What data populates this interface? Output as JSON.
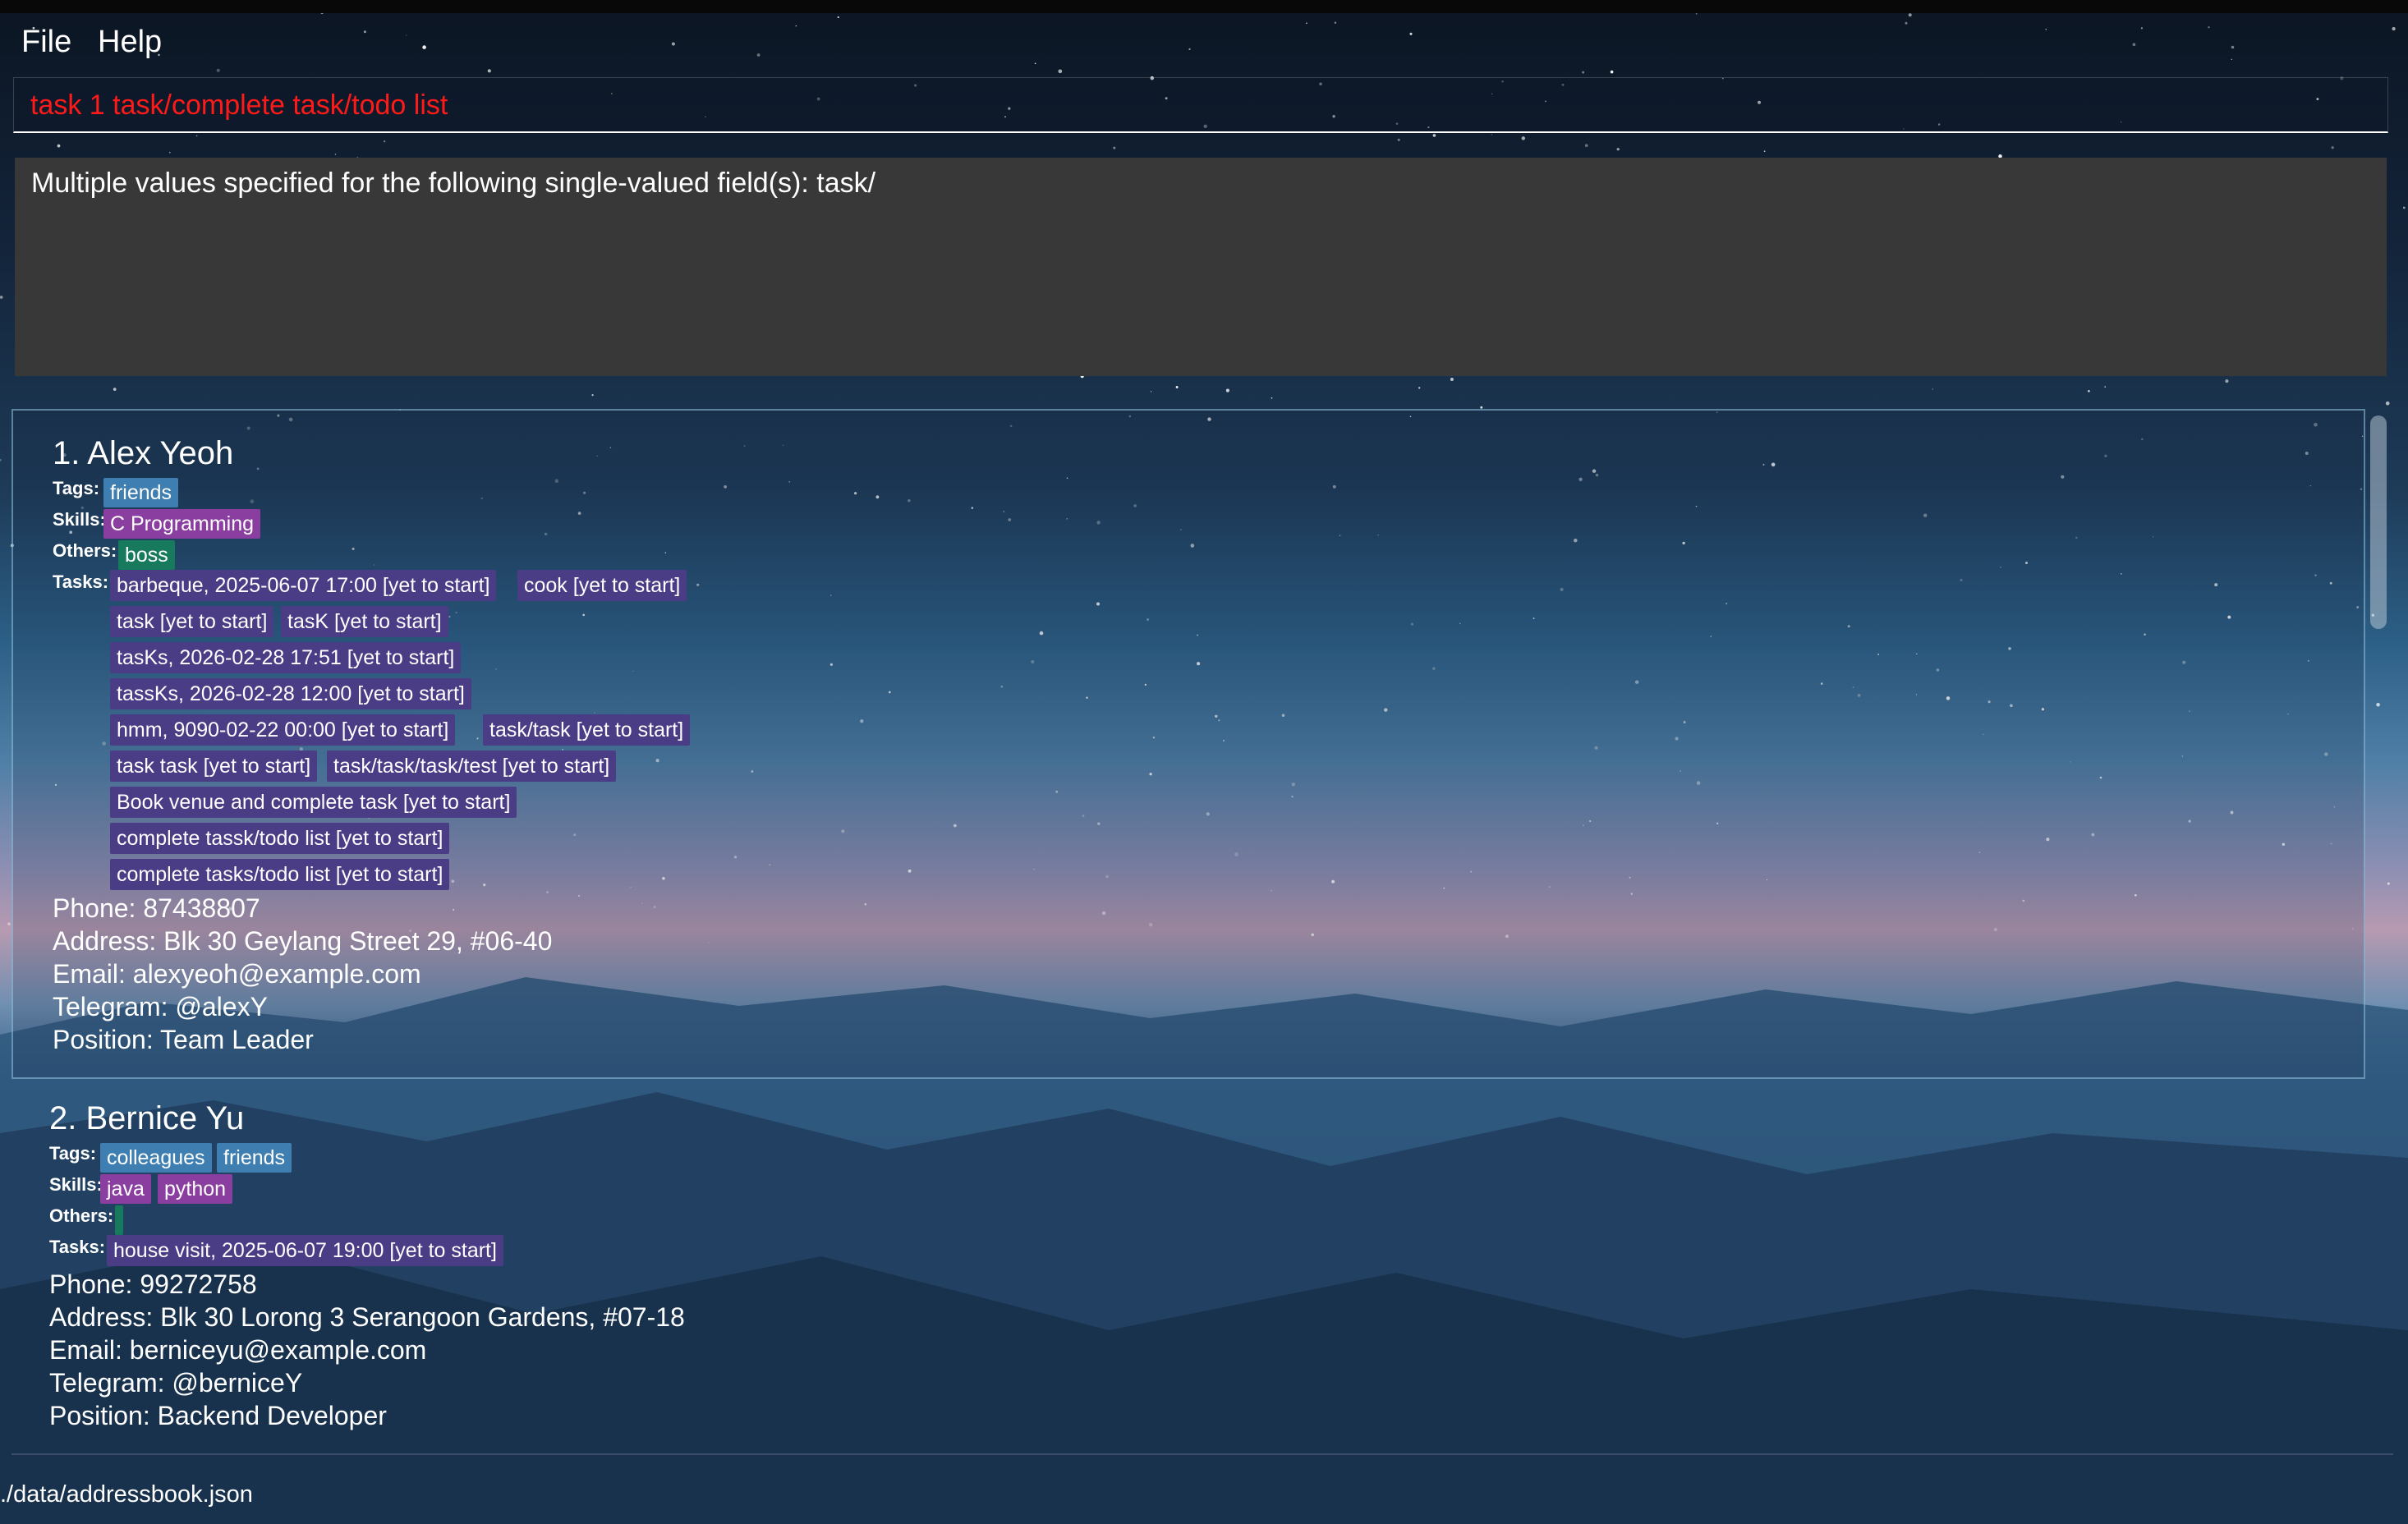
{
  "menu": {
    "file": "File",
    "help": "Help"
  },
  "command": {
    "value": "task 1 task/complete task/todo list",
    "color": "#ff1a1a"
  },
  "result": {
    "message": "Multiple values specified for the following single-valued field(s): task/"
  },
  "labels": {
    "tags": "Tags:",
    "skills": "Skills:",
    "others": "Others:",
    "tasks": "Tasks:"
  },
  "colors": {
    "tag": "#3e7eb0",
    "skill": "#8a3fa0",
    "other": "#187a5c",
    "task": "#4b3c86",
    "result_background": "#383838"
  },
  "persons": [
    {
      "name": "1. Alex Yeoh",
      "tags": [
        "friends"
      ],
      "skills": [
        "C Programming"
      ],
      "others": [
        "boss"
      ],
      "tasks": [
        "barbeque, 2025-06-07 17:00 [yet to start]",
        "cook [yet to start]",
        "task [yet to start]",
        "tasK [yet to start]",
        "tasKs, 2026-02-28 17:51 [yet to start]",
        "tassKs, 2026-02-28 12:00 [yet to start]",
        "hmm, 9090-02-22 00:00 [yet to start]",
        "task/task [yet to start]",
        "task task [yet to start]",
        "task/task/task/test [yet to start]",
        "Book venue and complete task [yet to start]",
        "complete tassk/todo list [yet to start]",
        "complete tasks/todo list [yet to start]"
      ],
      "phone": "Phone: 87438807",
      "address": "Address: Blk 30 Geylang Street 29, #06-40",
      "email": "Email: alexyeoh@example.com",
      "telegram": "Telegram: @alexY",
      "position": "Position: Team Leader"
    },
    {
      "name": "2. Bernice Yu",
      "tags": [
        "colleagues",
        "friends"
      ],
      "skills": [
        "java",
        "python"
      ],
      "others": [],
      "tasks": [
        "house visit, 2025-06-07 19:00 [yet to start]"
      ],
      "phone": "Phone: 99272758",
      "address": "Address: Blk 30 Lorong 3 Serangoon Gardens, #07-18",
      "email": "Email: berniceyu@example.com",
      "telegram": "Telegram: @berniceY",
      "position": "Position: Backend Developer"
    }
  ],
  "status": {
    "file_path": "./data/addressbook.json"
  }
}
